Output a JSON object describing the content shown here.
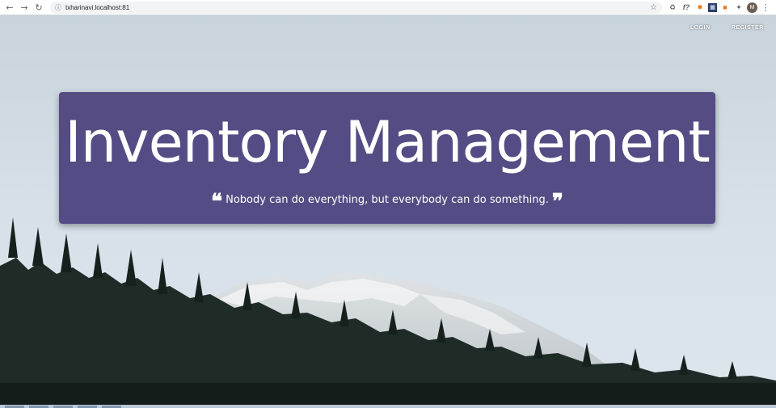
{
  "browser": {
    "url": "txharinavi.localhost:81",
    "toolbar_icons": [
      "back-icon",
      "forward-icon",
      "reload-icon",
      "info-icon",
      "star-icon"
    ],
    "extensions": [
      "recycle-icon",
      "fx-icon",
      "extension-orange-icon",
      "extension-box-icon",
      "lock-icon",
      "puzzle-icon"
    ],
    "avatar_letter": "M"
  },
  "nav": {
    "login": "LOGIN",
    "register": "REGISTER"
  },
  "hero": {
    "title": "Inventory Management",
    "quote": "Nobody can do everything, but everybody can do something.",
    "card_color": "#504780"
  },
  "colors": {
    "sky": "#cfd9e1",
    "forest": "#1d2a26",
    "snow": "#e8ecef"
  }
}
